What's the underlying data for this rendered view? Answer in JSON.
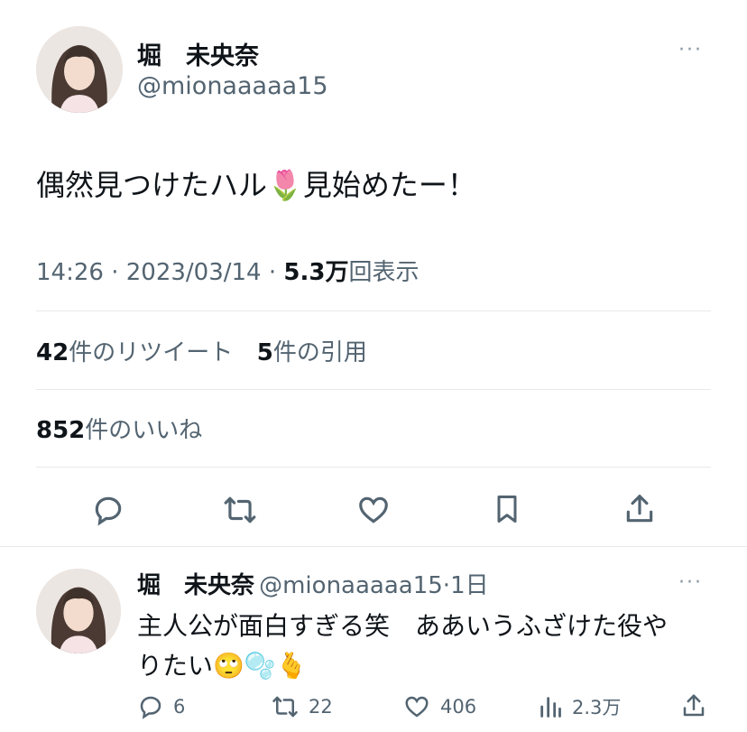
{
  "tweet": {
    "author_name": "堀　未央奈",
    "author_handle": "@mionaaaaa15",
    "text_part1": "偶然見つけたハル",
    "text_emoji": "🌷",
    "text_part2": "見始めたー！",
    "time": "14:26",
    "separator": "·",
    "date": "2023/03/14",
    "views_count": "5.3万",
    "views_label": "回表示",
    "retweets_count": "42",
    "retweets_label": "件のリツイート",
    "quotes_count": "5",
    "quotes_label": "件の引用",
    "likes_count": "852",
    "likes_label": "件のいいね",
    "more": "···"
  },
  "actions": [
    "reply-icon",
    "retweet-icon",
    "like-icon",
    "bookmark-icon",
    "share-icon"
  ],
  "reply": {
    "author_name": "堀　未央奈",
    "author_handle": "@mionaaaaa15",
    "separator": "·",
    "age": "1日",
    "text_line1": "主人公が面白すぎる笑　ああいうふざけた役や",
    "text_line2": "りたい🙄🫧🫰",
    "more": "···",
    "replies": "6",
    "retweets": "22",
    "likes": "406",
    "views": "2.3万"
  }
}
